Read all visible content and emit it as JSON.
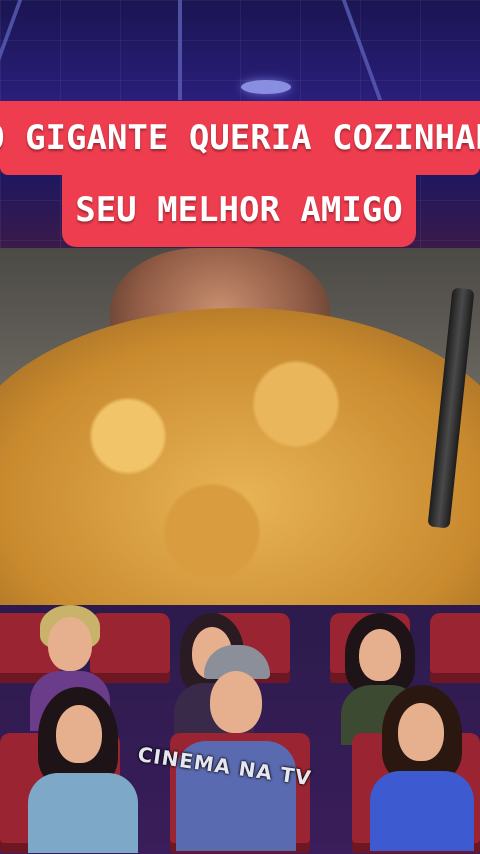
{
  "caption": {
    "line1": "O GIGANTE QUERIA COZINHAR",
    "line2": "SEU MELHOR AMIGO"
  },
  "watermark": "CINEMA NA TV",
  "colors": {
    "caption_bg": "#ee3d4e",
    "caption_text": "#ffffff",
    "theater_top": "#2a1e7a",
    "seat": "#9a2432"
  }
}
